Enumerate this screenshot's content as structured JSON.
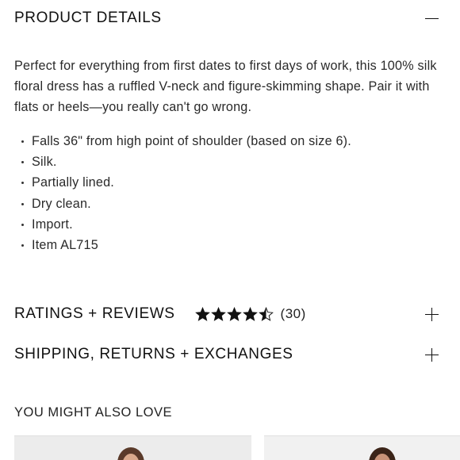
{
  "product_details": {
    "title": "PRODUCT DETAILS",
    "toggle_state": "expanded",
    "description": "Perfect for everything from first dates to first days of work, this 100% silk floral dress has a ruffled V-neck and figure-skimming shape. Pair it with flats or heels—you really can't go wrong.",
    "bullets": [
      "Falls 36\" from high point of shoulder (based on size 6).",
      "Silk.",
      "Partially lined.",
      "Dry clean.",
      "Import.",
      "Item AL715"
    ]
  },
  "ratings_reviews": {
    "title": "RATINGS + REVIEWS",
    "rating": 4.5,
    "max_rating": 5,
    "count_label": "(30)",
    "toggle_state": "collapsed"
  },
  "shipping": {
    "title": "SHIPPING, RETURNS + EXCHANGES",
    "toggle_state": "collapsed"
  },
  "recommendations": {
    "title": "YOU MIGHT ALSO LOVE",
    "cards": [
      {
        "image": "product-photo-model"
      },
      {
        "image": "product-photo-model"
      }
    ]
  },
  "colors": {
    "text": "#1a1a1a",
    "star": "#111111"
  }
}
